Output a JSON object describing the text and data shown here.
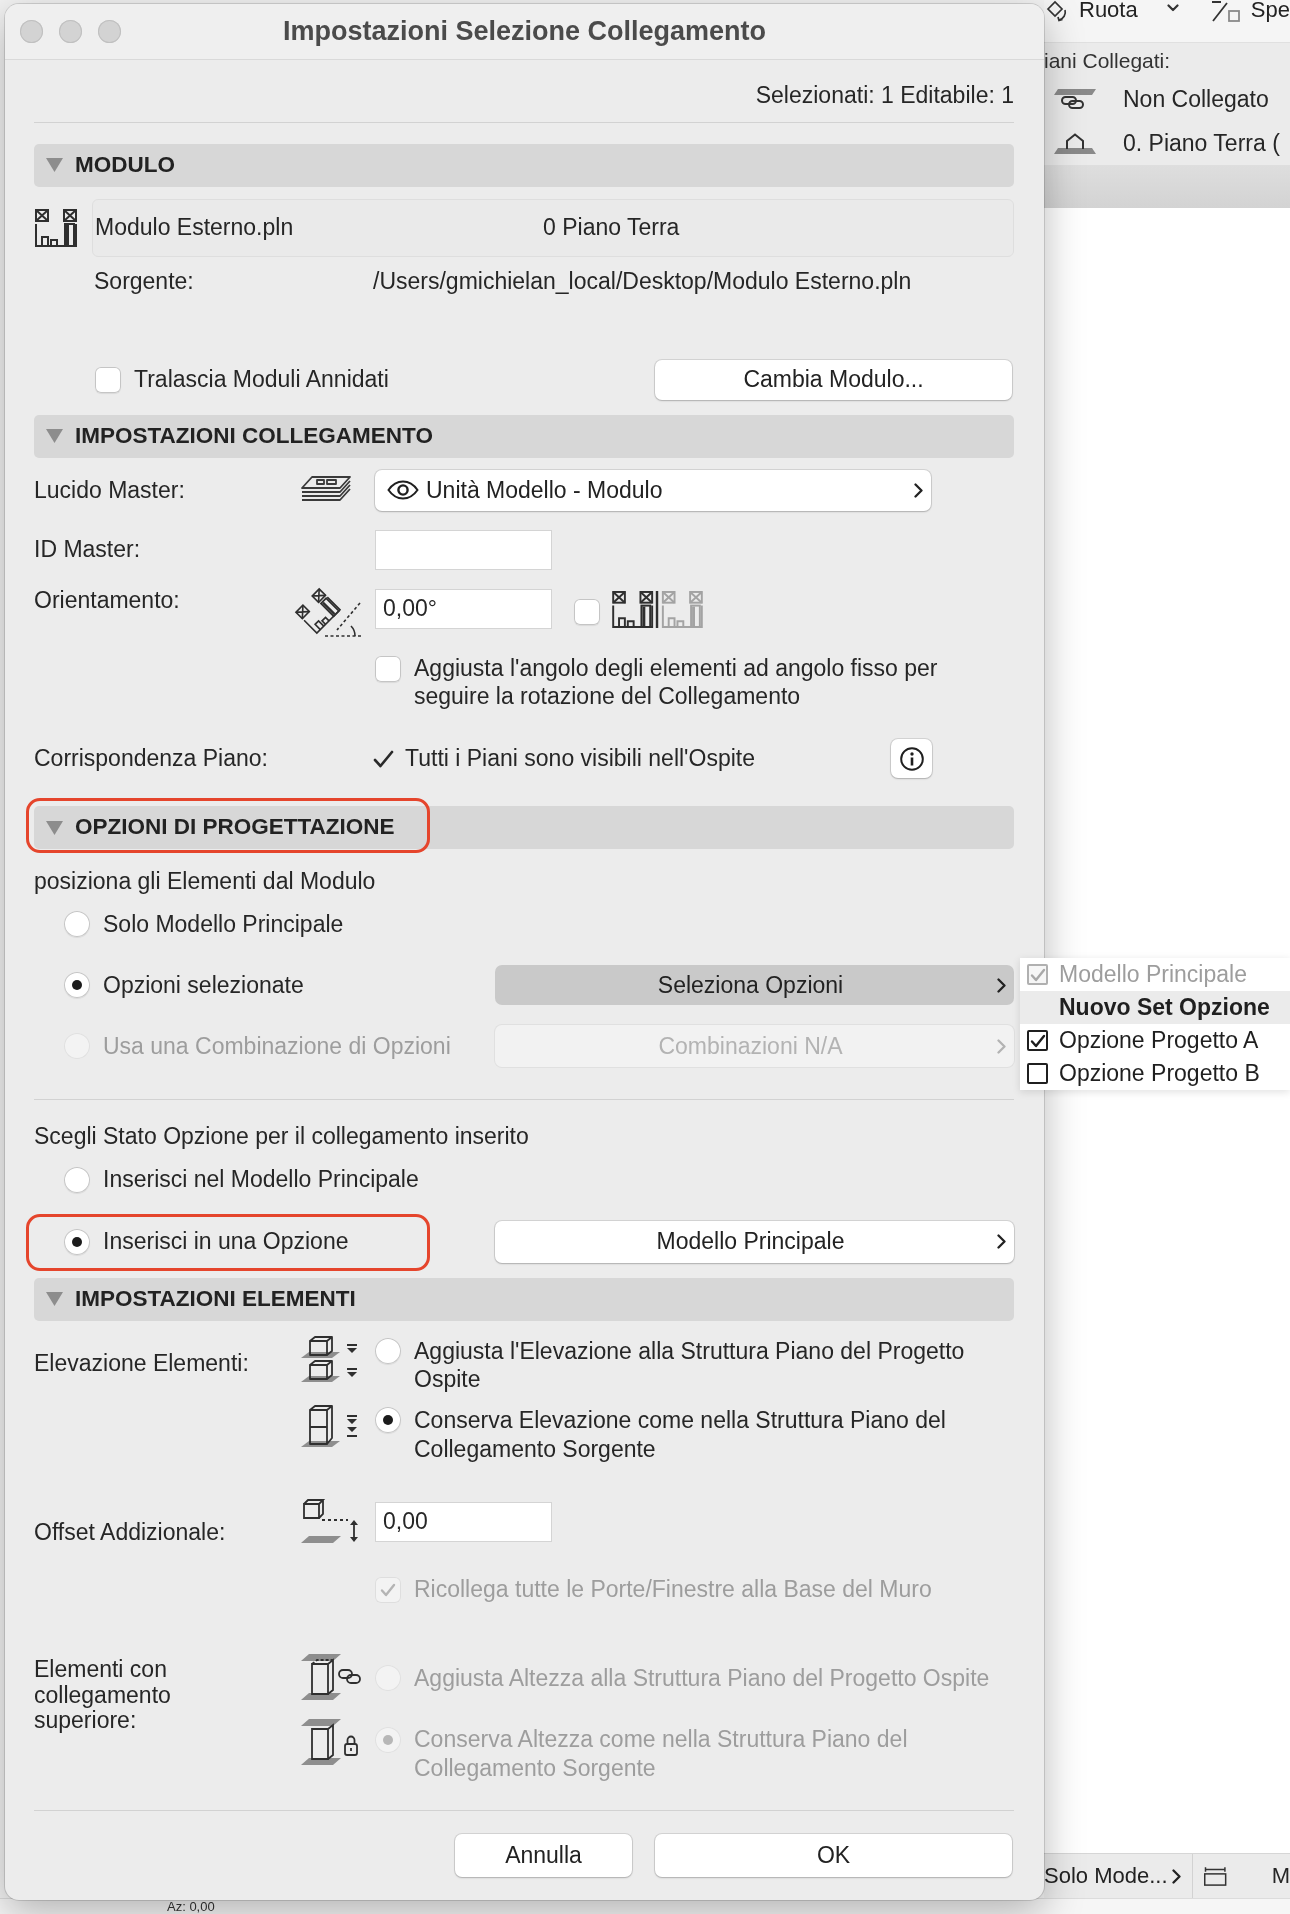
{
  "dialog": {
    "title": "Impostazioni Selezione Collegamento",
    "selection_info": "Selezionati: 1 Editabile: 1"
  },
  "module": {
    "header": "MODULO",
    "file_name": "Modulo Esterno.pln",
    "story": "0 Piano Terra",
    "source_label": "Sorgente:",
    "source_path": "/Users/gmichielan_local/Desktop/Modulo Esterno.pln",
    "skip_nested": {
      "label": "Tralascia Moduli Annidati",
      "checked": false
    },
    "change_button": "Cambia Modulo..."
  },
  "link_settings": {
    "header": "IMPOSTAZIONI COLLEGAMENTO",
    "master_layer": {
      "label": "Lucido Master:",
      "value": "Unità Modello - Modulo"
    },
    "master_id": {
      "label": "ID Master:"
    },
    "orientation": {
      "label": "Orientamento:",
      "value": "0,00°",
      "mirrored": false
    },
    "fix_angle": {
      "label": "Aggiusta l'angolo degli elementi ad angolo fisso per seguire la rotazione del Collegamento",
      "checked": false
    },
    "story_match": {
      "label": "Corrispondenza Piano:",
      "value": "Tutti i Piani sono visibili nell'Ospite"
    }
  },
  "design_options": {
    "header": "OPZIONI DI PROGETTAZIONE",
    "highlighted": true,
    "placement_label": "posiziona gli Elementi dal Modulo",
    "placement": [
      {
        "label": "Solo Modello Principale",
        "selected": false,
        "disabled": false
      },
      {
        "label": "Opzioni selezionate",
        "selected": true,
        "disabled": false,
        "button": {
          "label": "Seleziona Opzioni",
          "pressed": true,
          "disabled": false
        }
      },
      {
        "label": "Usa una Combinazione di Opzioni",
        "selected": false,
        "disabled": true,
        "button": {
          "label": "Combinazioni N/A",
          "pressed": false,
          "disabled": true
        }
      }
    ],
    "status_label": "Scegli Stato Opzione per il collegamento inserito",
    "status": [
      {
        "label": "Inserisci nel Modello Principale",
        "selected": false,
        "highlighted": false
      },
      {
        "label": "Inserisci in una Opzione",
        "selected": true,
        "highlighted": true,
        "button": {
          "label": "Modello Principale",
          "pressed": false,
          "disabled": false
        }
      }
    ]
  },
  "element_settings": {
    "header": "IMPOSTAZIONI ELEMENTI",
    "elevation": {
      "label": "Elevazione Elementi:",
      "options": [
        {
          "label": "Aggiusta l'Elevazione alla Struttura Piano del Progetto Ospite",
          "selected": false,
          "disabled": false
        },
        {
          "label": "Conserva Elevazione come nella Struttura Piano del Collegamento Sorgente",
          "selected": true,
          "disabled": false
        }
      ]
    },
    "offset": {
      "label": "Offset Addizionale:",
      "value": "0,00"
    },
    "reconnect": {
      "label": "Ricollega tutte le Porte/Finestre alla Base del Muro",
      "checked": true,
      "disabled": true
    },
    "top_linked": {
      "label": "Elementi con collegamento superiore:",
      "options": [
        {
          "label": "Aggiusta Altezza alla Struttura Piano del Progetto Ospite",
          "selected": false,
          "disabled": true
        },
        {
          "label": "Conserva Altezza come nella Struttura Piano del Collegamento Sorgente",
          "selected": true,
          "disabled": true
        }
      ]
    }
  },
  "buttons": [
    "Annulla",
    "OK"
  ],
  "options_menu": {
    "items": [
      {
        "label": "Modello Principale",
        "kind": "option",
        "checked": true,
        "disabled": true,
        "selected": false
      },
      {
        "label": "Nuovo Set Opzione",
        "kind": "set",
        "selected": true
      },
      {
        "label": "Opzione Progetto A",
        "kind": "option",
        "checked": true,
        "disabled": false,
        "selected": false
      },
      {
        "label": "Opzione Progetto B",
        "kind": "option",
        "checked": false,
        "disabled": false,
        "selected": false
      }
    ]
  },
  "background_app": {
    "toolbar": {
      "rotate_label": "Ruota",
      "cut_label": "Spe"
    },
    "linked_stories": {
      "heading": "iani Collegati:",
      "items": [
        {
          "label": "Non Collegato",
          "kind": "unlinked"
        },
        {
          "label": "0. Piano Terra (",
          "kind": "story"
        }
      ]
    },
    "bottom_bar": {
      "view_label": "Solo Mode...",
      "cut_label": "M"
    },
    "status": "Az: 0,00"
  }
}
